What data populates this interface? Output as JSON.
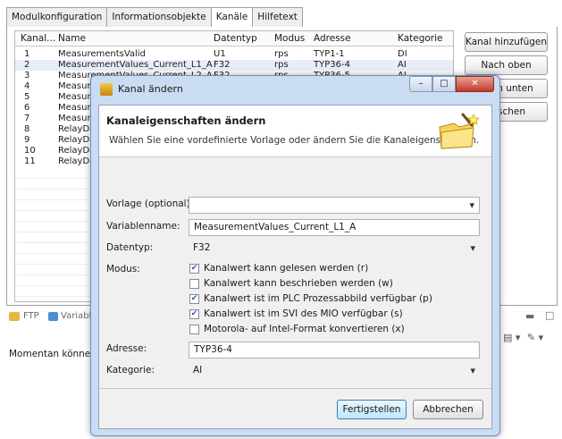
{
  "tabs": [
    {
      "label": "Modulkonfiguration"
    },
    {
      "label": "Informationsobjekte"
    },
    {
      "label": "Kanäle"
    },
    {
      "label": "Hilfetext"
    }
  ],
  "table": {
    "columns": [
      "Kanal...",
      "Name",
      "Datentyp",
      "Modus",
      "Adresse",
      "Kategorie"
    ],
    "rows": [
      {
        "no": "1",
        "name": "MeasurementsValid",
        "type": "U1",
        "mode": "rps",
        "addr": "TYP1-1",
        "cat": "DI"
      },
      {
        "no": "2",
        "name": "MeasurementValues_Current_L1_A",
        "type": "F32",
        "mode": "rps",
        "addr": "TYP36-4",
        "cat": "AI"
      },
      {
        "no": "3",
        "name": "MeasurementValues_Current_L2_A",
        "type": "F32",
        "mode": "rps",
        "addr": "TYP36-5",
        "cat": "AI"
      },
      {
        "no": "4",
        "name": "Measur",
        "type": "",
        "mode": "",
        "addr": "",
        "cat": ""
      },
      {
        "no": "5",
        "name": "Measur",
        "type": "",
        "mode": "",
        "addr": "",
        "cat": ""
      },
      {
        "no": "6",
        "name": "Measur",
        "type": "",
        "mode": "",
        "addr": "",
        "cat": ""
      },
      {
        "no": "7",
        "name": "Measur",
        "type": "",
        "mode": "",
        "addr": "",
        "cat": ""
      },
      {
        "no": "8",
        "name": "RelayDa",
        "type": "",
        "mode": "",
        "addr": "",
        "cat": ""
      },
      {
        "no": "9",
        "name": "RelayDa",
        "type": "",
        "mode": "",
        "addr": "",
        "cat": ""
      },
      {
        "no": "10",
        "name": "RelayDa",
        "type": "",
        "mode": "",
        "addr": "",
        "cat": ""
      },
      {
        "no": "11",
        "name": "RelayDa",
        "type": "",
        "mode": "",
        "addr": "",
        "cat": ""
      }
    ]
  },
  "side_buttons": {
    "add": "Kanal hinzufügen",
    "up": "Nach oben",
    "down": "Nach unten",
    "delete": "Löschen"
  },
  "bottom": {
    "ftp": "FTP",
    "variables": "Variabl",
    "status_text": "Momentan können l"
  },
  "dialog": {
    "title": "Kanal ändern",
    "heading": "Kanaleigenschaften ändern",
    "description": "Wählen Sie eine vordefinierte Vorlage oder ändern Sie die Kanaleigenschaften.",
    "template_label": "Vorlage (optional):",
    "template_value": "",
    "varname_label": "Variablenname:",
    "varname_value": "MeasurementValues_Current_L1_A",
    "type_label": "Datentyp:",
    "type_value": "F32",
    "mode_label": "Modus:",
    "checkboxes": [
      {
        "label": "Kanalwert kann gelesen werden (r)",
        "checked": true
      },
      {
        "label": "Kanalwert kann beschrieben werden (w)",
        "checked": false
      },
      {
        "label": "Kanalwert ist im PLC Prozessabbild verfügbar (p)",
        "checked": true
      },
      {
        "label": "Kanalwert ist im SVI des MIO verfügbar (s)",
        "checked": true
      },
      {
        "label": "Motorola- auf Intel-Format konvertieren (x)",
        "checked": false
      }
    ],
    "address_label": "Adresse:",
    "address_value": "TYP36-4",
    "category_label": "Kategorie:",
    "category_value": "AI",
    "finish": "Fertigstellen",
    "cancel": "Abbrechen"
  }
}
